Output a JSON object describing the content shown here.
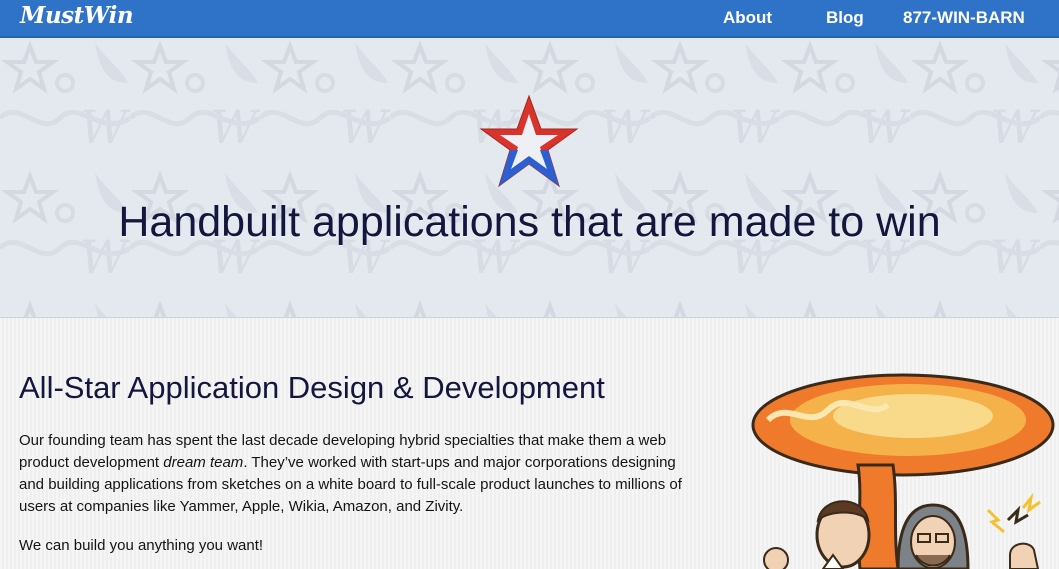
{
  "nav": {
    "logo": "MustWin",
    "links": [
      "About",
      "Blog",
      "877-WIN-BARN"
    ]
  },
  "hero": {
    "headline": "Handbuilt applications that are made to win",
    "icon": "star-logo-icon",
    "colors": {
      "star_red": "#d9342b",
      "star_blue": "#2c5fcf",
      "headline": "#14173d"
    }
  },
  "section": {
    "title": "All-Star Application Design & Development",
    "para1_a": "Our founding team has spent the last decade developing hybrid specialties that make them a web product development ",
    "para1_em": "dream team",
    "para1_b": ". They’ve worked with start-ups and major corporations designing and building applications from sketches on a white board to full-scale product launches to millions of users at companies like Yammer, Apple, Wikia, Amazon, and Zivity.",
    "para2": "We can build you anything you want!"
  },
  "colors": {
    "nav_bg": "#2f73c9",
    "hero_bg": "#e4e8ef"
  }
}
